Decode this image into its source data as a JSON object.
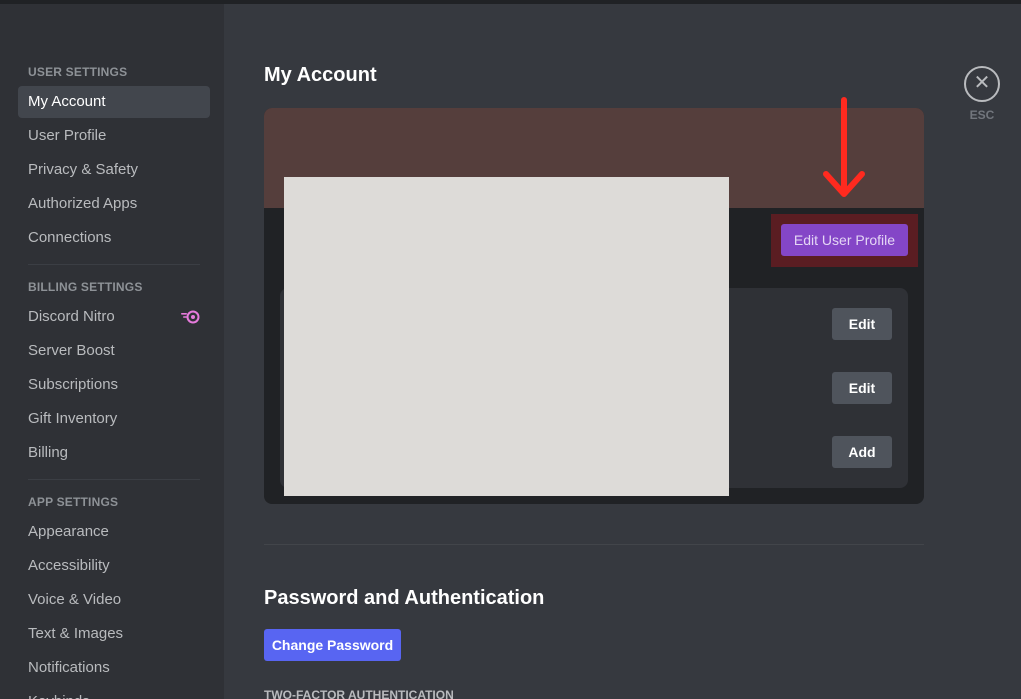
{
  "sidebar": {
    "user_settings": {
      "header": "User Settings",
      "items": [
        "My Account",
        "User Profile",
        "Privacy & Safety",
        "Authorized Apps",
        "Connections"
      ]
    },
    "billing_settings": {
      "header": "Billing Settings",
      "items": [
        "Discord Nitro",
        "Server Boost",
        "Subscriptions",
        "Gift Inventory",
        "Billing"
      ]
    },
    "app_settings": {
      "header": "App Settings",
      "items": [
        "Appearance",
        "Accessibility",
        "Voice & Video",
        "Text & Images",
        "Notifications",
        "Keybinds"
      ]
    },
    "active_item": "My Account"
  },
  "main": {
    "title": "My Account",
    "close_label": "ESC",
    "profile_card": {
      "edit_profile_label": "Edit User Profile",
      "field_buttons": [
        "Edit",
        "Edit",
        "Add"
      ]
    },
    "password_section": {
      "title": "Password and Authentication",
      "change_password_label": "Change Password",
      "two_factor_label": "Two-Factor Authentication"
    }
  },
  "colors": {
    "accent": "#5865f2",
    "nitro": "#8446c7",
    "banner": "#553e3c",
    "annotation_arrow": "#ff2a1f"
  }
}
